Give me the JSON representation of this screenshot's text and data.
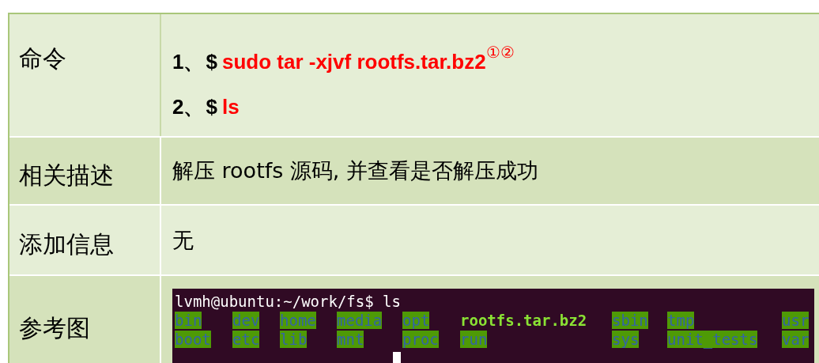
{
  "rows": [
    {
      "label": "命令",
      "kind": "commands",
      "commands": [
        {
          "number": "1、",
          "prompt": "$",
          "command": "sudo tar -xjvf rootfs.tar.bz2",
          "note": "①②"
        },
        {
          "number": "2、",
          "prompt": "$",
          "command": "ls"
        }
      ]
    },
    {
      "label": "相关描述",
      "kind": "text",
      "text": "解压 rootfs 源码, 并查看是否解压成功"
    },
    {
      "label": "添加信息",
      "kind": "text",
      "text": "无"
    },
    {
      "label": "参考图",
      "kind": "terminal",
      "terminal": {
        "prompt": "lvmh@ubuntu:~/work/fs$ ls",
        "entries": [
          {
            "name": "bin",
            "kind": "dir"
          },
          {
            "name": "dev",
            "kind": "dir"
          },
          {
            "name": "home",
            "kind": "dir"
          },
          {
            "name": "media",
            "kind": "dir"
          },
          {
            "name": "opt",
            "kind": "dir"
          },
          {
            "name": "rootfs.tar.bz2",
            "kind": "archive"
          },
          {
            "name": "sbin",
            "kind": "dir"
          },
          {
            "name": "tmp",
            "kind": "dir"
          },
          {
            "name": "usr",
            "kind": "dir"
          },
          {
            "name": "boot",
            "kind": "dir"
          },
          {
            "name": "etc",
            "kind": "dir"
          },
          {
            "name": "lib",
            "kind": "dir"
          },
          {
            "name": "mnt",
            "kind": "dir"
          },
          {
            "name": "proc",
            "kind": "dir"
          },
          {
            "name": "run",
            "kind": "dir"
          },
          {
            "name": "sys",
            "kind": "dir"
          },
          {
            "name": "unit_tests",
            "kind": "dir"
          },
          {
            "name": "var",
            "kind": "dir"
          }
        ]
      }
    }
  ]
}
